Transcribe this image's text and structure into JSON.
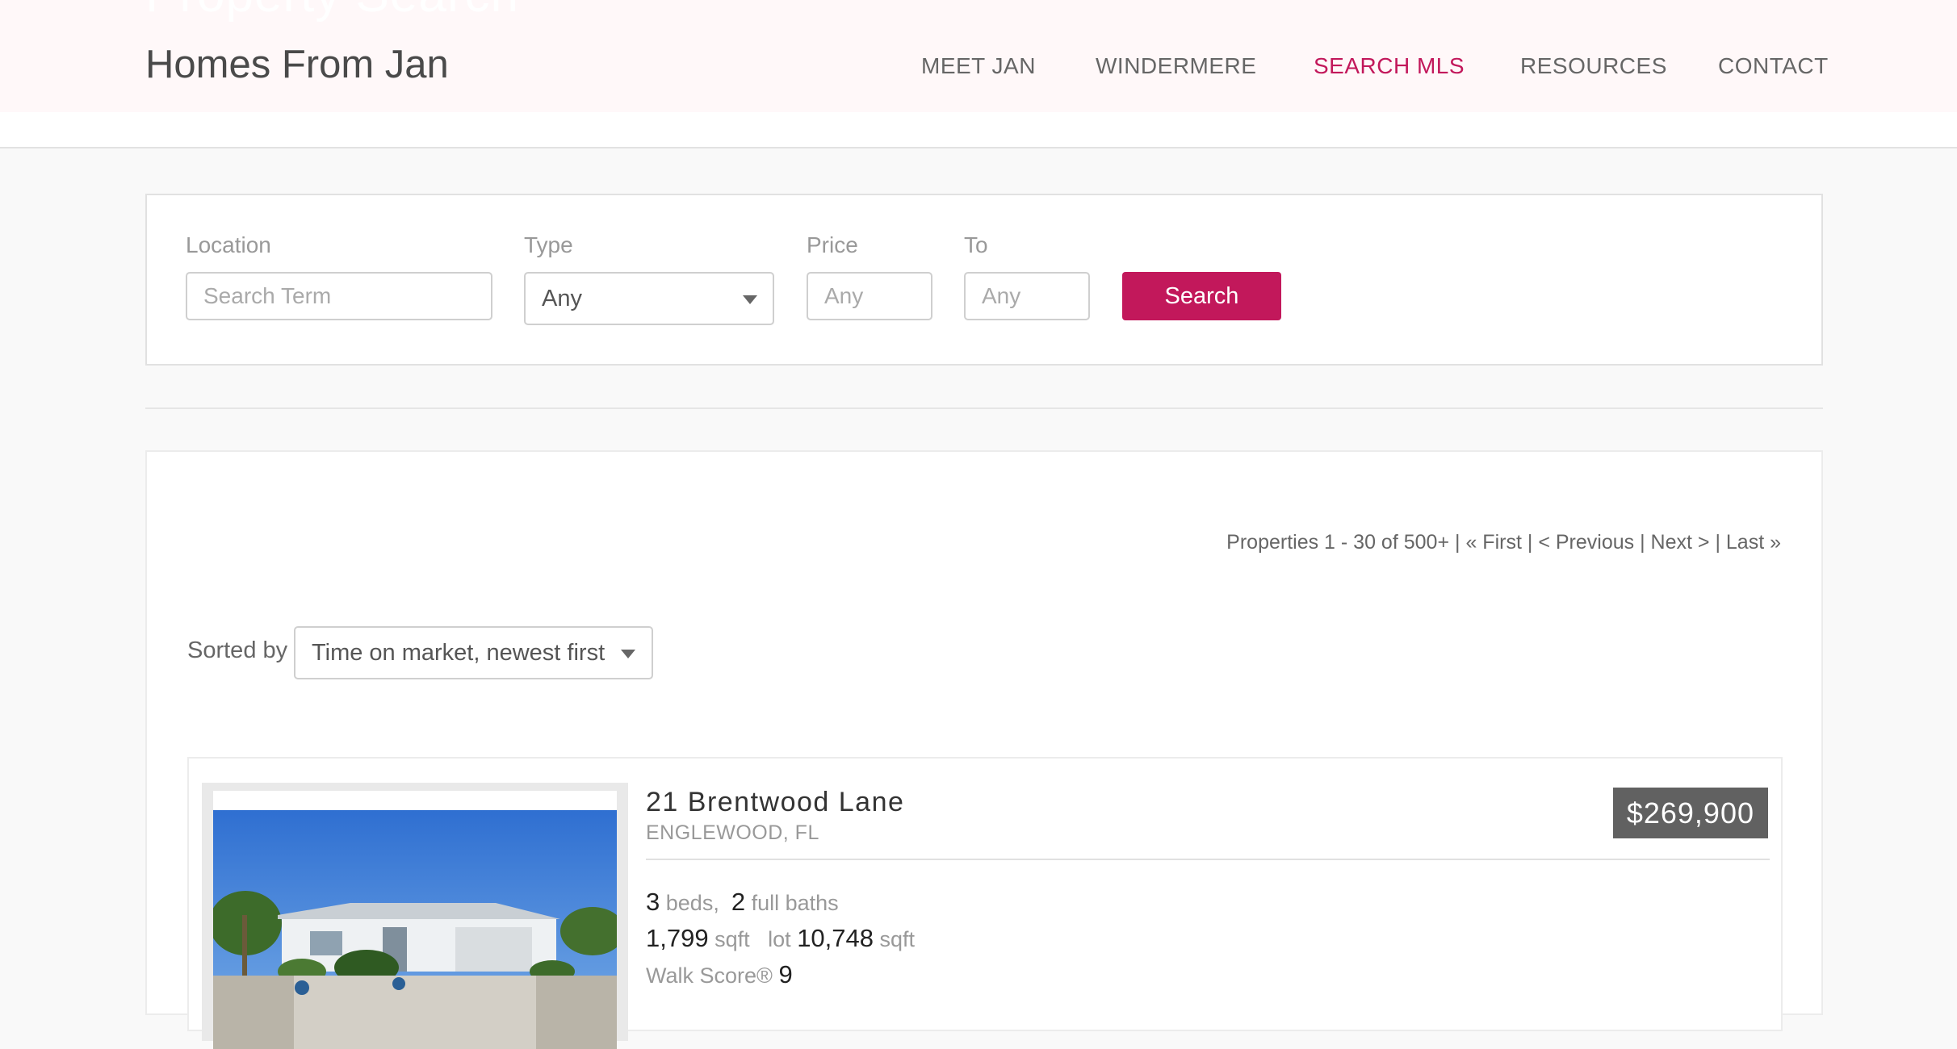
{
  "hero": {
    "title": "Property Search"
  },
  "header": {
    "brand": "Homes From Jan",
    "nav": [
      {
        "label": "MEET JAN",
        "active": false
      },
      {
        "label": "WINDERMERE",
        "active": false
      },
      {
        "label": "SEARCH MLS",
        "active": true
      },
      {
        "label": "RESOURCES",
        "active": false
      },
      {
        "label": "CONTACT",
        "active": false
      }
    ]
  },
  "search": {
    "location_label": "Location",
    "location_placeholder": "Search Term",
    "type_label": "Type",
    "type_value": "Any",
    "price_label": "Price",
    "price_placeholder": "Any",
    "to_label": "To",
    "to_placeholder": "Any",
    "button_label": "Search"
  },
  "results": {
    "pagination": {
      "summary": "Properties 1 - 30 of 500+",
      "sep": "|",
      "first": "« First",
      "previous": "< Previous",
      "next": "Next >",
      "last": "Last »"
    },
    "sort_label": "Sorted by",
    "sort_value": "Time on market, newest first"
  },
  "listing": {
    "address": "21 Brentwood Lane",
    "city": "ENGLEWOOD, FL",
    "price": "$269,900",
    "beds": "3",
    "beds_label": "beds,",
    "baths": "2",
    "baths_label": "full baths",
    "sqft": "1,799",
    "sqft_label": "sqft",
    "lot_label": "lot",
    "lot": "10,748",
    "lot_unit": "sqft",
    "walk_label": "Walk Score®",
    "walk_score": "9"
  },
  "colors": {
    "accent": "#c2185b",
    "header_bg": "#fff8f9",
    "price_badge": "#616161"
  },
  "icons": {
    "dropdown": "chevron-down-icon"
  }
}
